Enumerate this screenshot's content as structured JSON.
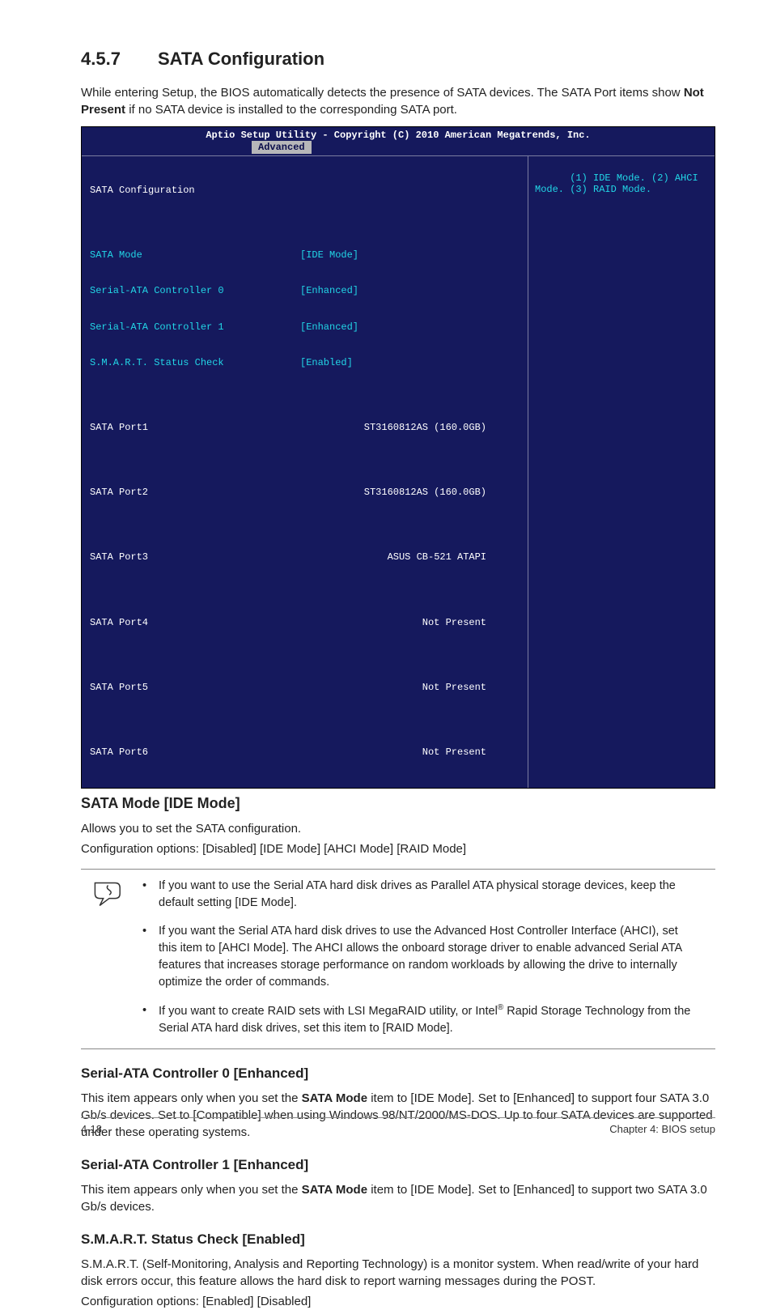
{
  "section": {
    "number": "4.5.7",
    "title": "SATA Configuration"
  },
  "intro": {
    "pre": "While entering Setup, the BIOS automatically detects the presence of SATA devices. The SATA Port items show ",
    "bold": "Not Present",
    "post": " if no SATA device is installed to the corresponding SATA port."
  },
  "bios": {
    "title": "Aptio Setup Utility - Copyright (C) 2010 American Megatrends, Inc.",
    "tab": "Advanced",
    "heading": "SATA Configuration",
    "settings": [
      {
        "label": "SATA Mode",
        "value": "[IDE Mode]"
      },
      {
        "label": "Serial-ATA Controller 0",
        "value": "[Enhanced]"
      },
      {
        "label": "Serial-ATA Controller 1",
        "value": "[Enhanced]"
      },
      {
        "label": "S.M.A.R.T. Status Check",
        "value": "[Enabled]"
      }
    ],
    "ports": [
      {
        "label": "SATA Port1",
        "value": "ST3160812AS (160.0GB)"
      },
      {
        "label": "SATA Port2",
        "value": "ST3160812AS (160.0GB)"
      },
      {
        "label": "SATA Port3",
        "value": "ASUS CB-521 ATAPI"
      },
      {
        "label": "SATA Port4",
        "value": "Not Present"
      },
      {
        "label": "SATA Port5",
        "value": "Not Present"
      },
      {
        "label": "SATA Port6",
        "value": "Not Present"
      }
    ],
    "help": "(1) IDE Mode. (2) AHCI Mode. (3) RAID Mode."
  },
  "sata_mode": {
    "heading": "SATA Mode [IDE Mode]",
    "line1": "Allows you to set the SATA configuration.",
    "line2": "Configuration options: [Disabled] [IDE Mode] [AHCI Mode] [RAID Mode]"
  },
  "notes": {
    "n1": "If you want to use the Serial ATA hard disk drives as Parallel ATA physical storage devices, keep the default setting [IDE Mode].",
    "n2": "If you want the Serial ATA hard disk drives to use the Advanced Host Controller Interface (AHCI), set this item to [AHCI Mode]. The AHCI allows the onboard storage driver to enable advanced Serial ATA features that increases storage performance on random workloads by allowing the drive to internally optimize the order of commands.",
    "n3_pre": "If you want to create RAID sets with LSI MegaRAID utility, or Intel",
    "n3_post": " Rapid Storage Technology from the Serial ATA hard disk drives, set this item to [RAID Mode]."
  },
  "ctrl0": {
    "heading": "Serial-ATA Controller 0 [Enhanced]",
    "pre": "This item appears only when you set the ",
    "bold": "SATA Mode",
    "post": " item to [IDE Mode]. Set to [Enhanced] to support four SATA 3.0 Gb/s devices. Set to [Compatible] when using Windows 98/NT/2000/MS-DOS. Up to four SATA devices are supported under these operating systems."
  },
  "ctrl1": {
    "heading": "Serial-ATA Controller 1 [Enhanced]",
    "pre": "This item appears only when you set the ",
    "bold": "SATA Mode",
    "post": " item to [IDE Mode]. Set to [Enhanced] to support two SATA 3.0 Gb/s devices."
  },
  "smart": {
    "heading": "S.M.A.R.T. Status Check [Enabled]",
    "p1": "S.M.A.R.T. (Self-Monitoring, Analysis and Reporting Technology) is a monitor system. When read/write of your hard disk errors occur, this feature allows the hard disk to report warning messages during the POST.",
    "p2": "Configuration options: [Enabled] [Disabled]"
  },
  "footer": {
    "left": "4-18",
    "right": "Chapter 4: BIOS setup"
  }
}
